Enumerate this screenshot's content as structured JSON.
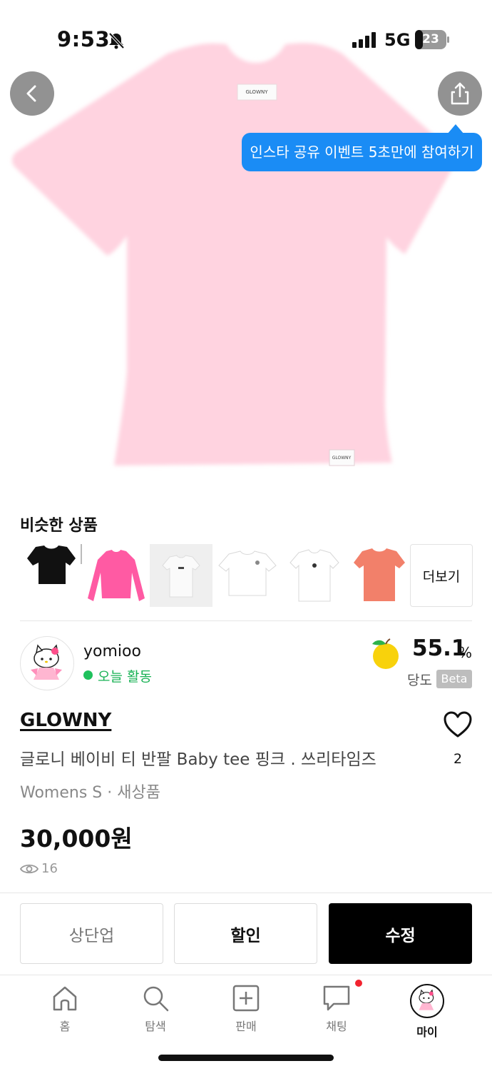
{
  "status_bar": {
    "time": "9:53",
    "network": "5G",
    "battery": "23"
  },
  "tooltip": {
    "text": "인스타 공유 이벤트 5초만에 참여하기"
  },
  "similar": {
    "title": "비슷한 상품",
    "more_label": "더보기"
  },
  "seller": {
    "name": "yomioo",
    "activity": "오늘 활동",
    "sweetness_value": "55.1",
    "sweetness_unit": "%",
    "sweetness_label": "당도",
    "beta": "Beta"
  },
  "product": {
    "brand": "GLOWNY",
    "title": "글로니 베이비 티 반팔 Baby tee 핑크 . 쓰리타임즈",
    "meta": "Womens S · 새상품",
    "price": "30,000원",
    "views": "16",
    "likes": "2"
  },
  "actions": {
    "bump": "상단업",
    "discount": "할인",
    "edit": "수정"
  },
  "tabbar": {
    "home": "홈",
    "search": "탐색",
    "sell": "판매",
    "chat": "채팅",
    "my": "마이"
  },
  "colors": {
    "accent_blue": "#1a8cf5",
    "active_green": "#1fc15c",
    "notification_red": "#f2232f",
    "shirt_pink": "#ffd3e0"
  }
}
